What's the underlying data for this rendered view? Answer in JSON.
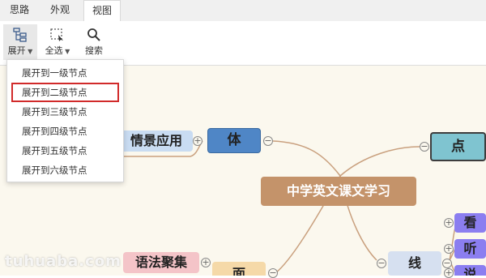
{
  "tabs": [
    {
      "label": "思路"
    },
    {
      "label": "外观"
    },
    {
      "label": "视图"
    }
  ],
  "toolbar": {
    "expand_label": "展开",
    "select_all_label": "全选",
    "search_label": "搜索"
  },
  "expand_menu": {
    "items": [
      {
        "label": "展开到一级节点"
      },
      {
        "label": "展开到二级节点"
      },
      {
        "label": "展开到三级节点"
      },
      {
        "label": "展开到四级节点"
      },
      {
        "label": "展开到五级节点"
      },
      {
        "label": "展开到六级节点"
      }
    ],
    "highlighted": "展开到二级节点"
  },
  "mindmap": {
    "root": "中学英文课文学习",
    "branch_ti": "体",
    "branch_dian": "点",
    "branch_xian": "线",
    "branch_mian": "面",
    "leaf_qingjing": "情景应用",
    "leaf_yufa": "语法聚集",
    "leaf_kan": "看",
    "leaf_ting": "听",
    "leaf_shuo": "说"
  },
  "watermark": "tuhuaba.com",
  "colors": {
    "accent_highlight": "#d12a2a",
    "root_fill": "#c4936a",
    "branch_ti_fill": "#4f86c6",
    "branch_dian_fill": "#7fc4d0",
    "branch_xian_fill": "#d6e0f0",
    "leaf_pink": "#f4c4c8",
    "leaf_blue": "#c9dcf2",
    "leaf_purple": "#8b7ef0",
    "link_color": "#c9a07e"
  }
}
